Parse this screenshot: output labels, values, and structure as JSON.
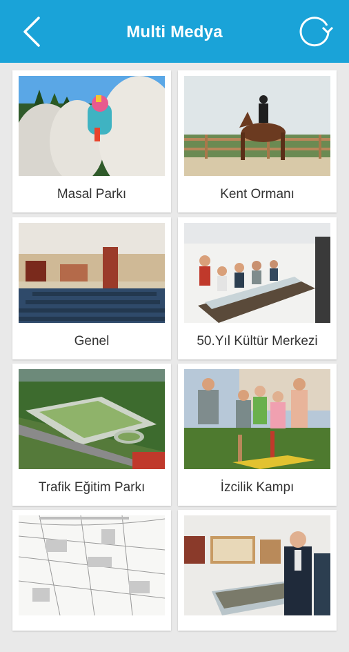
{
  "header": {
    "title": "Multi Medya",
    "back_icon": "back-chevron-icon",
    "refresh_icon": "refresh-icon",
    "background_color": "#1aa3d8"
  },
  "gallery": {
    "items": [
      {
        "label": "Masal Parkı"
      },
      {
        "label": "Kent Ormanı"
      },
      {
        "label": "Genel"
      },
      {
        "label": "50.Yıl Kültür Merkezi"
      },
      {
        "label": "Trafik Eğitim Parkı"
      },
      {
        "label": "İzcilik Kampı"
      },
      {
        "label": ""
      },
      {
        "label": ""
      }
    ]
  }
}
